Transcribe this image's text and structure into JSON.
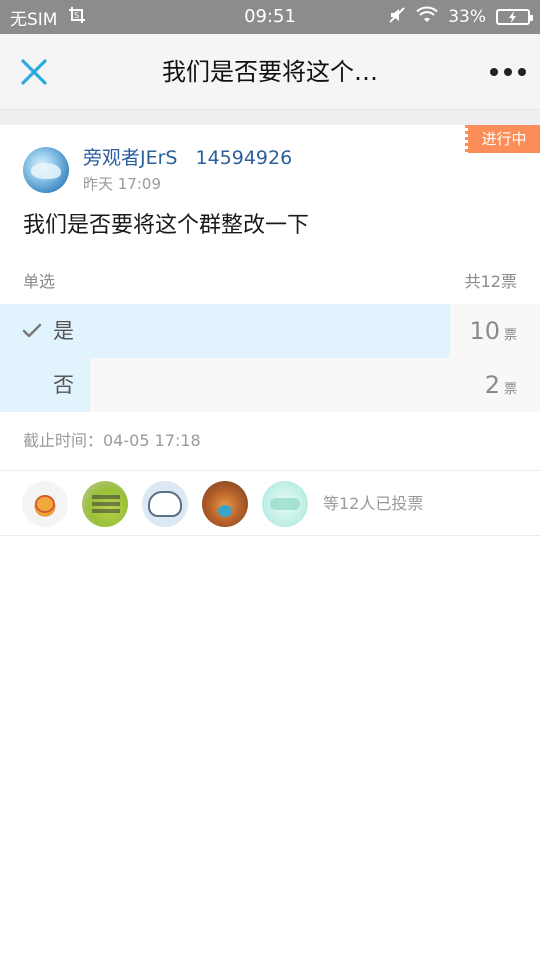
{
  "status_bar": {
    "carrier": "无SIM",
    "time": "09:51",
    "battery": "33%",
    "icons": [
      "screenshot-icon",
      "mute-icon",
      "wifi-icon",
      "battery-charging-icon"
    ]
  },
  "nav": {
    "title": "我们是否要将这个…",
    "close_icon": "close-icon",
    "more_icon": "more-icon"
  },
  "post": {
    "status_tag": "进行中",
    "author_name": "旁观者JErS",
    "author_id": "14594926",
    "time": "昨天 17:09",
    "question": "我们是否要将这个群整改一下"
  },
  "vote": {
    "type_label": "单选",
    "total_label": "共12票",
    "options": [
      {
        "label": "是",
        "count": "10",
        "unit": "票",
        "selected": true,
        "fraction": 0.833
      },
      {
        "label": "否",
        "count": "2",
        "unit": "票",
        "selected": false,
        "fraction": 0.167
      }
    ],
    "deadline": "截止时间：04-05 17:18"
  },
  "voters": {
    "summary": "等12人已投票"
  },
  "colors": {
    "accent_blue": "#2c5f9c",
    "close_blue": "#2aa9e0",
    "tag_orange": "#fb8d58",
    "bar_fill": "#e1f4fd"
  }
}
